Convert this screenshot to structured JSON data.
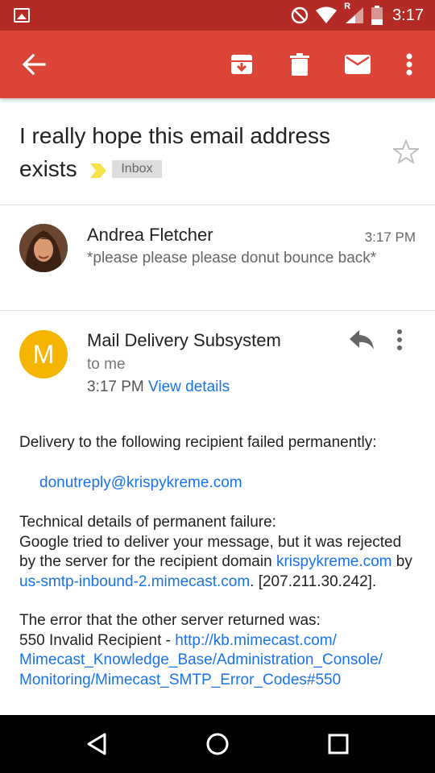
{
  "status_bar": {
    "time": "3:17",
    "roaming": "R"
  },
  "app_bar": {
    "back_icon": "arrow-back-icon",
    "archive_icon": "archive-icon",
    "delete_icon": "trash-icon",
    "mark_unread_icon": "mail-icon",
    "more_icon": "more-vert-icon"
  },
  "subject": {
    "text": "I really hope this email address exists",
    "label": "Inbox"
  },
  "message1": {
    "sender": "Andrea Fletcher",
    "time": "3:17 PM",
    "snippet": "*please please please donut bounce back*"
  },
  "message2": {
    "avatar_letter": "M",
    "avatar_color": "#f4b400",
    "sender": "Mail Delivery Subsystem",
    "to": "to me",
    "time": "3:17 PM",
    "view_details": "View details",
    "body": {
      "line1": "Delivery to the following recipient failed permanently:",
      "recipient": "donutreply@krispykreme.com",
      "tech_heading": "Technical details of permanent failure:",
      "tech_text_a": "Google tried to deliver your message, but it was rejected by the server for the recipient domain ",
      "tech_link_domain": "krispykreme.com",
      "tech_by": " by ",
      "tech_link_server": "us-smtp-inbound-2.mimecast.com",
      "tech_ip": ". [207.211.30.242].",
      "error_heading": "The error that the other server returned was:",
      "error_code": "550 Invalid Recipient - ",
      "error_link": "http://kb.mimecast.com/Mimecast_Knowledge_Base/Administration_Console/Monitoring/Mimecast_SMTP_Error_Codes#550"
    }
  },
  "nav_bar": {
    "back": "nav-back-icon",
    "home": "nav-home-icon",
    "recents": "nav-recents-icon"
  },
  "colors": {
    "status_bar": "#b32b24",
    "app_bar": "#db4437",
    "link": "#1a73e8"
  }
}
